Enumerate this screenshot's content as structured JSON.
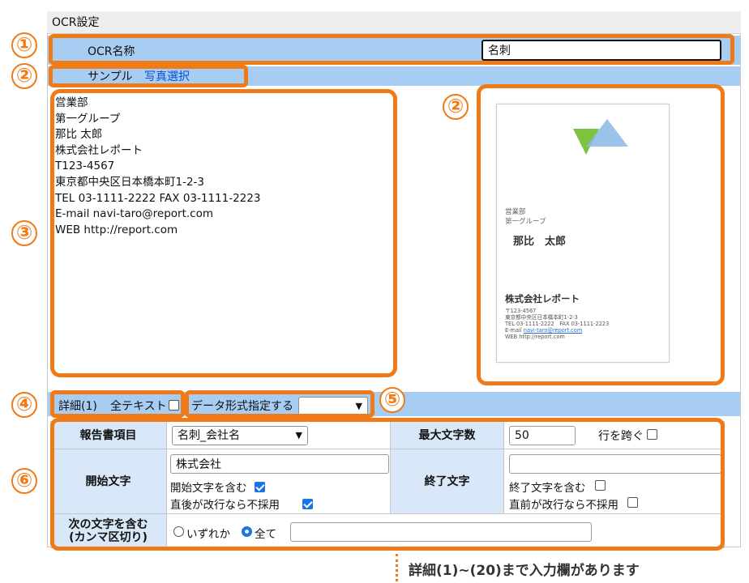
{
  "panel_title": "OCR設定",
  "ocr_name": {
    "label": "OCR名称",
    "value": "名刺"
  },
  "sample": {
    "label": "サンプル",
    "link": "写真選択"
  },
  "ocr_text": "営業部\n第一グループ\n那比 太郎\n株式会社レポート\nT123-4567\n東京都中央区日本橋本町1-2-3\nTEL 03-1111-2222 FAX 03-1111-2223\nE-mail navi-taro@report.com\nWEB http://report.com",
  "card": {
    "dept": "営業部",
    "group": "第一グループ",
    "name": "那比　太郎",
    "company": "株式会社レポート",
    "postal": "〒123-4567",
    "address": "東京都中央区日本橋本町1-2-3",
    "tel": "TEL 03-1111-2222　FAX 03-1111-2223",
    "email_label": "E-mail",
    "email": "navi-taro@report.com",
    "web": "WEB http://report.com",
    "colors": {
      "green": "#7dc241",
      "blue": "#8ab8e6"
    }
  },
  "detail": {
    "label": "詳細(1)",
    "fulltext_label": "全テキスト",
    "fulltext_checked": false,
    "format_label": "データ形式指定する",
    "format_value": ""
  },
  "table": {
    "report_item_label": "報告書項目",
    "report_item_value": "名刺_会社名",
    "max_chars_label": "最大文字数",
    "max_chars_value": "50",
    "cross_line_label": "行を跨ぐ",
    "cross_line_checked": false,
    "start_label": "開始文字",
    "start_value": "株式会社",
    "start_include_label": "開始文字を含む",
    "start_include_checked": true,
    "after_newline_label": "直後が改行なら不採用",
    "after_newline_checked": true,
    "end_label": "終了文字",
    "end_value": "",
    "end_include_label": "終了文字を含む",
    "end_include_checked": false,
    "before_newline_label": "直前が改行なら不採用",
    "before_newline_checked": false,
    "next_contains_label_1": "次の文字を含む",
    "next_contains_label_2": "(カンマ区切り)",
    "radio_any": "いずれか",
    "radio_all": "全て",
    "radio_selected": "all",
    "next_value": ""
  },
  "callouts": [
    "①",
    "②",
    "②",
    "③",
    "④",
    "⑤",
    "⑥"
  ],
  "footnote": "詳細(1)~(20)まで入力欄があります",
  "accent_color": "#f07a18"
}
